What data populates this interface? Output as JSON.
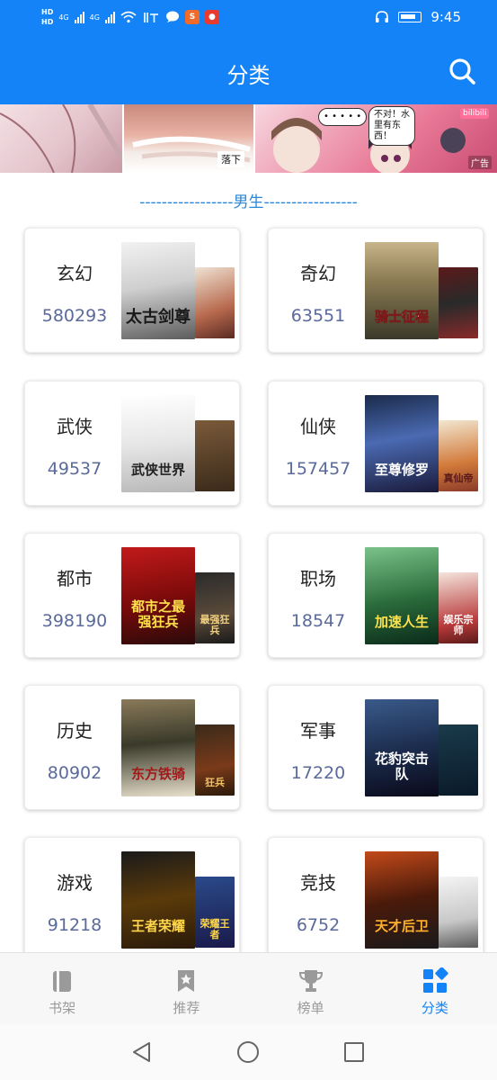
{
  "status_bar": {
    "hd1": "HD",
    "hd2": "HD",
    "net1": "4G",
    "net2": "4G",
    "time": "9:45",
    "app_icon_1": "soul-app-icon",
    "app_icon_2": "weibo-app-icon"
  },
  "header": {
    "title": "分类",
    "search_icon": "search-icon"
  },
  "ad": {
    "panel2_caption": "落下",
    "panel3_bubble_1": "• • • • •",
    "panel3_bubble_2": "不对！水里有东西！",
    "panel3_logo": "bilibili",
    "tag": "广告"
  },
  "section": {
    "title": "-----------------男生-----------------"
  },
  "categories": [
    {
      "name": "玄幻",
      "count": "580293",
      "cover_main_title": "太古剑尊",
      "cover_back_title": ""
    },
    {
      "name": "奇幻",
      "count": "63551",
      "cover_main_title": "骑士征程",
      "cover_back_title": ""
    },
    {
      "name": "武侠",
      "count": "49537",
      "cover_main_title": "武侠世界",
      "cover_back_title": ""
    },
    {
      "name": "仙侠",
      "count": "157457",
      "cover_main_title": "至尊修罗",
      "cover_back_title": "真仙帝"
    },
    {
      "name": "都市",
      "count": "398190",
      "cover_main_title": "都市之最强狂兵",
      "cover_back_title": "最强狂兵"
    },
    {
      "name": "职场",
      "count": "18547",
      "cover_main_title": "加速人生",
      "cover_back_title": "娱乐宗师"
    },
    {
      "name": "历史",
      "count": "80902",
      "cover_main_title": "东方铁骑",
      "cover_back_title": "狂兵"
    },
    {
      "name": "军事",
      "count": "17220",
      "cover_main_title": "花豹突击队",
      "cover_back_title": ""
    },
    {
      "name": "游戏",
      "count": "91218",
      "cover_main_title": "王者荣耀",
      "cover_back_title": "荣耀王者"
    },
    {
      "name": "竞技",
      "count": "6752",
      "cover_main_title": "天才后卫",
      "cover_back_title": ""
    }
  ],
  "bottom_nav": {
    "items": [
      {
        "label": "书架",
        "icon": "bookshelf-icon",
        "active": false
      },
      {
        "label": "推荐",
        "icon": "bookmark-star-icon",
        "active": false
      },
      {
        "label": "榜单",
        "icon": "trophy-icon",
        "active": false
      },
      {
        "label": "分类",
        "icon": "category-grid-icon",
        "active": true
      }
    ]
  },
  "system_nav": {
    "back_icon": "back-triangle-icon",
    "home_icon": "home-circle-icon",
    "recents_icon": "recents-square-icon"
  },
  "colors": {
    "primary": "#1483f7",
    "section_title": "#2a86d8",
    "count_text": "#5a6a9a",
    "nav_inactive": "#9a9a9a"
  }
}
